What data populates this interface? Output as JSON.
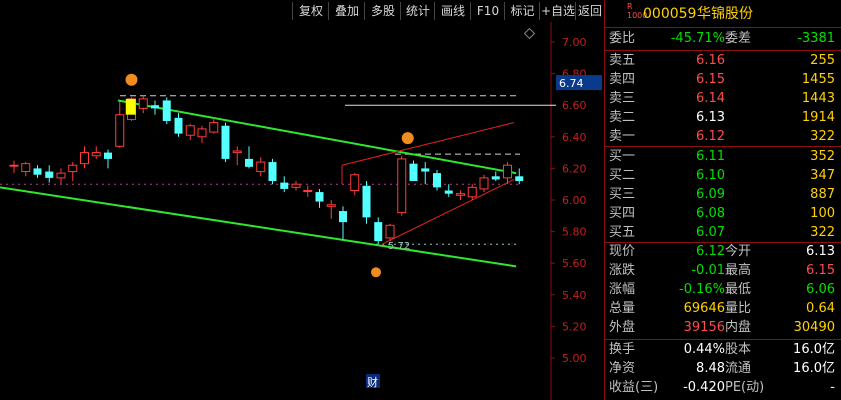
{
  "toolbar": {
    "buttons": [
      "复权",
      "叠加",
      "多股",
      "统计",
      "画线",
      "F10",
      "标记",
      "+自选",
      "返回"
    ]
  },
  "stock": {
    "badge_top": "R",
    "badge_bottom": "1000",
    "code": "000059",
    "name": "华锦股份"
  },
  "summary": {
    "weibi_label": "委比",
    "weibi_value": "-45.71%",
    "weicha_label": "委差",
    "weicha_value": "-3381"
  },
  "sells": [
    {
      "label": "卖五",
      "price": "6.16",
      "vol": "255"
    },
    {
      "label": "卖四",
      "price": "6.15",
      "vol": "1455"
    },
    {
      "label": "卖三",
      "price": "6.14",
      "vol": "1443"
    },
    {
      "label": "卖二",
      "price": "6.13",
      "vol": "1914"
    },
    {
      "label": "卖一",
      "price": "6.12",
      "vol": "322"
    }
  ],
  "buys": [
    {
      "label": "买一",
      "price": "6.11",
      "vol": "352"
    },
    {
      "label": "买二",
      "price": "6.10",
      "vol": "347"
    },
    {
      "label": "买三",
      "price": "6.09",
      "vol": "887"
    },
    {
      "label": "买四",
      "price": "6.08",
      "vol": "100"
    },
    {
      "label": "买五",
      "price": "6.07",
      "vol": "322"
    }
  ],
  "quote": [
    {
      "l1": "现价",
      "v1": "6.12",
      "l2": "今开",
      "v2": "6.13"
    },
    {
      "l1": "涨跌",
      "v1": "-0.01",
      "l2": "最高",
      "v2": "6.15"
    },
    {
      "l1": "涨幅",
      "v1": "-0.16%",
      "l2": "最低",
      "v2": "6.06"
    },
    {
      "l1": "总量",
      "v1": "69646",
      "l2": "量比",
      "v2": "0.64"
    },
    {
      "l1": "外盘",
      "v1": "39156",
      "l2": "内盘",
      "v2": "30490"
    }
  ],
  "fundamentals": [
    {
      "l1": "换手",
      "v1": "0.44%",
      "l2": "股本",
      "v2": "16.0亿"
    },
    {
      "l1": "净资",
      "v1": "8.48",
      "l2": "流通",
      "v2": "16.0亿"
    },
    {
      "l1": "收益(三)",
      "v1": "-0.420",
      "l2": "PE(动)",
      "v2": "-"
    }
  ],
  "chart": {
    "price_tag": "6.74",
    "low_marker": "5.72",
    "finance_marker": "财",
    "axis_ticks": [
      "7.00",
      "6.80",
      "6.60",
      "6.40",
      "6.20",
      "6.00",
      "5.80",
      "5.60",
      "5.40",
      "5.20",
      "5.00"
    ]
  },
  "chart_data": {
    "type": "candlestick",
    "ylim": [
      4.96,
      7.08
    ],
    "candles": [
      {
        "o": 6.22,
        "h": 6.25,
        "l": 6.17,
        "c": 6.22
      },
      {
        "o": 6.18,
        "h": 6.24,
        "l": 6.15,
        "c": 6.23
      },
      {
        "o": 6.2,
        "h": 6.22,
        "l": 6.14,
        "c": 6.16
      },
      {
        "o": 6.18,
        "h": 6.22,
        "l": 6.11,
        "c": 6.14
      },
      {
        "o": 6.14,
        "h": 6.2,
        "l": 6.1,
        "c": 6.17
      },
      {
        "o": 6.18,
        "h": 6.24,
        "l": 6.12,
        "c": 6.22
      },
      {
        "o": 6.23,
        "h": 6.34,
        "l": 6.2,
        "c": 6.3
      },
      {
        "o": 6.28,
        "h": 6.34,
        "l": 6.26,
        "c": 6.3
      },
      {
        "o": 6.3,
        "h": 6.32,
        "l": 6.2,
        "c": 6.26
      },
      {
        "o": 6.34,
        "h": 6.62,
        "l": 6.33,
        "c": 6.54
      },
      {
        "o": 6.51,
        "h": 6.65,
        "l": 6.5,
        "c": 6.64
      },
      {
        "o": 6.58,
        "h": 6.66,
        "l": 6.55,
        "c": 6.64
      },
      {
        "o": 6.6,
        "h": 6.63,
        "l": 6.54,
        "c": 6.58
      },
      {
        "o": 6.63,
        "h": 6.65,
        "l": 6.48,
        "c": 6.5
      },
      {
        "o": 6.52,
        "h": 6.55,
        "l": 6.4,
        "c": 6.42
      },
      {
        "o": 6.41,
        "h": 6.48,
        "l": 6.38,
        "c": 6.47
      },
      {
        "o": 6.4,
        "h": 6.47,
        "l": 6.36,
        "c": 6.45
      },
      {
        "o": 6.43,
        "h": 6.52,
        "l": 6.42,
        "c": 6.49
      },
      {
        "o": 6.47,
        "h": 6.49,
        "l": 6.24,
        "c": 6.26
      },
      {
        "o": 6.3,
        "h": 6.34,
        "l": 6.22,
        "c": 6.31
      },
      {
        "o": 6.26,
        "h": 6.34,
        "l": 6.2,
        "c": 6.21
      },
      {
        "o": 6.18,
        "h": 6.27,
        "l": 6.15,
        "c": 6.24
      },
      {
        "o": 6.24,
        "h": 6.26,
        "l": 6.1,
        "c": 6.12
      },
      {
        "o": 6.11,
        "h": 6.15,
        "l": 6.05,
        "c": 6.07
      },
      {
        "o": 6.08,
        "h": 6.12,
        "l": 6.06,
        "c": 6.1
      },
      {
        "o": 6.06,
        "h": 6.09,
        "l": 6.02,
        "c": 6.06
      },
      {
        "o": 6.05,
        "h": 6.07,
        "l": 5.95,
        "c": 5.99
      },
      {
        "o": 5.96,
        "h": 6.0,
        "l": 5.88,
        "c": 5.97
      },
      {
        "o": 5.93,
        "h": 5.96,
        "l": 5.75,
        "c": 5.86
      },
      {
        "o": 6.06,
        "h": 6.17,
        "l": 6.03,
        "c": 6.16
      },
      {
        "o": 6.09,
        "h": 6.12,
        "l": 5.85,
        "c": 5.89
      },
      {
        "o": 5.86,
        "h": 5.89,
        "l": 5.72,
        "c": 5.74
      },
      {
        "o": 5.76,
        "h": 5.85,
        "l": 5.74,
        "c": 5.84
      },
      {
        "o": 5.92,
        "h": 6.28,
        "l": 5.9,
        "c": 6.26
      },
      {
        "o": 6.23,
        "h": 6.25,
        "l": 6.12,
        "c": 6.12
      },
      {
        "o": 6.2,
        "h": 6.24,
        "l": 6.1,
        "c": 6.18
      },
      {
        "o": 6.17,
        "h": 6.19,
        "l": 6.06,
        "c": 6.08
      },
      {
        "o": 6.06,
        "h": 6.1,
        "l": 6.02,
        "c": 6.04
      },
      {
        "o": 6.03,
        "h": 6.06,
        "l": 6.0,
        "c": 6.04
      },
      {
        "o": 6.02,
        "h": 6.1,
        "l": 6.0,
        "c": 6.08
      },
      {
        "o": 6.07,
        "h": 6.16,
        "l": 6.05,
        "c": 6.14
      },
      {
        "o": 6.15,
        "h": 6.18,
        "l": 6.12,
        "c": 6.13
      },
      {
        "o": 6.14,
        "h": 6.24,
        "l": 6.1,
        "c": 6.22
      },
      {
        "o": 6.15,
        "h": 6.2,
        "l": 6.1,
        "c": 6.12
      }
    ],
    "dashed_levels": [
      6.66,
      6.29,
      6.1,
      5.72
    ],
    "white_level": 6.6,
    "channel_upper": [
      6.63,
      6.17
    ],
    "channel_lower": [
      6.08,
      5.58
    ],
    "red_channel": {
      "a": [
        6.22,
        6.49
      ],
      "b": [
        5.72,
        6.13
      ]
    }
  }
}
